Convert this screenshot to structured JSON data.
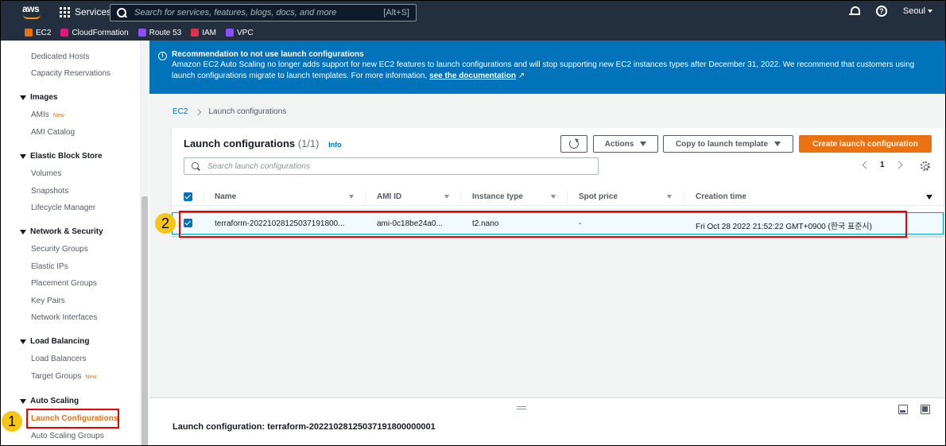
{
  "topnav": {
    "logo": "aws",
    "services_label": "Services",
    "search_placeholder": "Search for services, features, blogs, docs, and more",
    "search_shortcut": "[Alt+S]",
    "region": "Seoul"
  },
  "favorites": [
    {
      "label": "EC2",
      "color": "#ec7211"
    },
    {
      "label": "CloudFormation",
      "color": "#e7157b"
    },
    {
      "label": "Route 53",
      "color": "#8c4fff"
    },
    {
      "label": "IAM",
      "color": "#dd344c"
    },
    {
      "label": "VPC",
      "color": "#8c4fff"
    }
  ],
  "sidebar": {
    "items_top": [
      "Dedicated Hosts",
      "Capacity Reservations"
    ],
    "images": {
      "heading": "Images",
      "amis": "AMIs",
      "amis_badge": "New",
      "ami_catalog": "AMI Catalog"
    },
    "ebs": {
      "heading": "Elastic Block Store",
      "items": [
        "Volumes",
        "Snapshots",
        "Lifecycle Manager"
      ]
    },
    "network": {
      "heading": "Network & Security",
      "items": [
        "Security Groups",
        "Elastic IPs",
        "Placement Groups",
        "Key Pairs",
        "Network Interfaces"
      ]
    },
    "lb": {
      "heading": "Load Balancing",
      "load_balancers": "Load Balancers",
      "target_groups": "Target Groups",
      "target_groups_badge": "New"
    },
    "asg": {
      "heading": "Auto Scaling",
      "launch_configurations": "Launch Configurations",
      "auto_scaling_groups": "Auto Scaling Groups"
    }
  },
  "annotations": {
    "marker1": "1",
    "marker2": "2"
  },
  "banner": {
    "title": "Recommendation to not use launch configurations",
    "body": "Amazon EC2 Auto Scaling no longer adds support for new EC2 features to launch configurations and will stop supporting new EC2 instances types after December 31, 2022. We recommend that customers using launch configurations migrate to launch templates. For more information,",
    "link": "see the documentation"
  },
  "breadcrumb": {
    "root": "EC2",
    "current": "Launch configurations"
  },
  "panel": {
    "title": "Launch configurations",
    "count": "(1/1)",
    "info": "Info",
    "actions_label": "Actions",
    "copy_label": "Copy to launch template",
    "create_label": "Create launch configuration",
    "search_placeholder": "Search launch configurations",
    "page": "1"
  },
  "table": {
    "columns": [
      "Name",
      "AMI ID",
      "Instance type",
      "Spot price",
      "Creation time"
    ],
    "rows": [
      {
        "name": "terraform-20221028125037191800...",
        "ami_id": "ami-0c18be24a0...",
        "instance_type": "t2.nano",
        "spot_price": "-",
        "creation_time": "Fri Oct 28 2022 21:52:22 GMT+0900 (한국 표준시)"
      }
    ]
  },
  "details": {
    "title": "Launch configuration: terraform-20221028125037191800000001"
  }
}
